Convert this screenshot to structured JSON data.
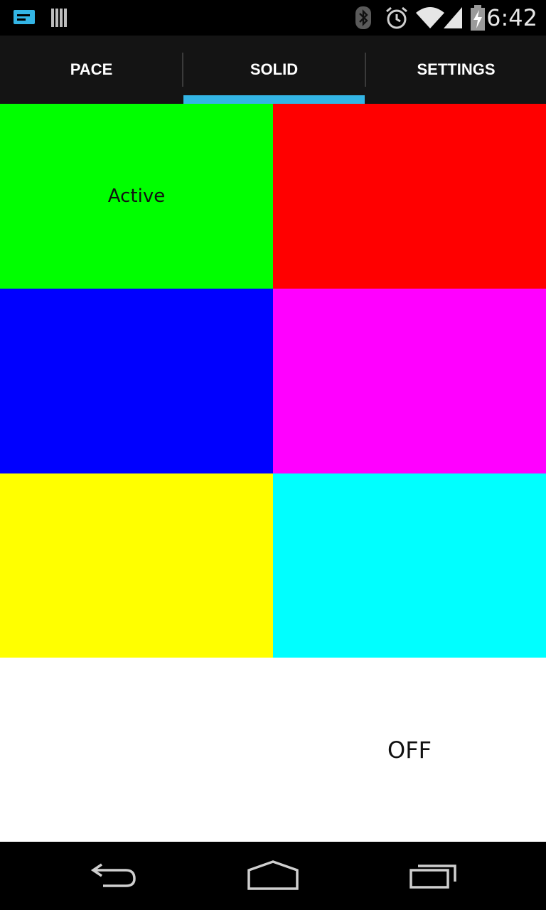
{
  "status_bar": {
    "time": "6:42",
    "icons": [
      "message-notification-icon",
      "barcode-notification-icon",
      "bluetooth-icon",
      "alarm-icon",
      "wifi-icon",
      "cell-signal-icon",
      "battery-charging-icon"
    ]
  },
  "tabs": [
    {
      "label": "PACE",
      "selected": false
    },
    {
      "label": "SOLID",
      "selected": true
    },
    {
      "label": "SETTINGS",
      "selected": false
    }
  ],
  "colors": {
    "accent": "#33b5e5",
    "tab_bar_bg": "#141414"
  },
  "swatches": [
    {
      "color": "#00ff00",
      "label": "Active"
    },
    {
      "color": "#ff0000",
      "label": ""
    },
    {
      "color": "#0000ff",
      "label": ""
    },
    {
      "color": "#ff00ff",
      "label": ""
    },
    {
      "color": "#ffff00",
      "label": ""
    },
    {
      "color": "#00ffff",
      "label": ""
    },
    {
      "color": "#ffffff",
      "label": ""
    },
    {
      "color": "#ffffff",
      "label": "OFF"
    }
  ],
  "nav_bar": {
    "icons": [
      "back-icon",
      "home-icon",
      "recent-apps-icon"
    ]
  }
}
